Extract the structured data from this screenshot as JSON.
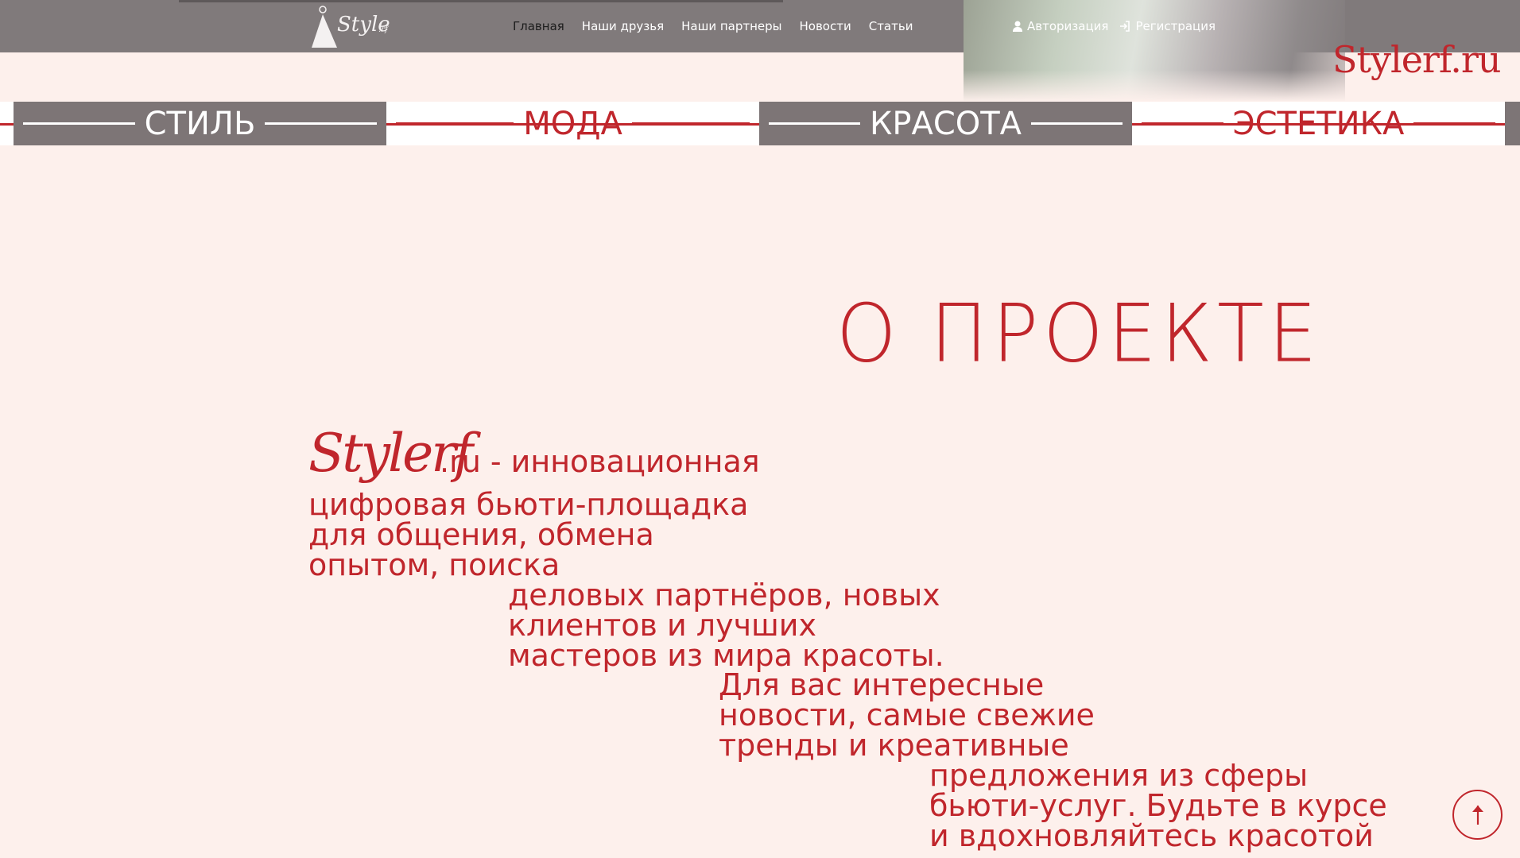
{
  "header": {
    "logo_text": "Style",
    "logo_suffix": ".rf",
    "nav": [
      {
        "label": "Главная",
        "active": true
      },
      {
        "label": "Наши друзья",
        "active": false
      },
      {
        "label": "Наши партнеры",
        "active": false
      },
      {
        "label": "Новости",
        "active": false
      },
      {
        "label": "Статьи",
        "active": false
      }
    ],
    "auth": {
      "login_label": "Авторизация",
      "register_label": "Регистрация"
    },
    "brand": "Stylerf.ru"
  },
  "strip": {
    "words": [
      "СТИЛЬ",
      "МОДА",
      "КРАСОТА",
      "ЭСТЕТИКА"
    ]
  },
  "about": {
    "title": "О ПРОЕКТЕ",
    "script_logo": "Stylerf",
    "lines": [
      ".ru - инновационная",
      "цифровая бьюти-площадка\nдля общения, обмена\nопытом, поиска",
      "деловых партнёров, новых\nклиентов и лучших\nмастеров из мира красоты.",
      "Для вас интересные\nновости, самые свежие\nтренды и креативные",
      "предложения из сферы\nбьюти-услуг. Будьте в курсе\nи вдохновляйтесь красотой"
    ]
  },
  "colors": {
    "accent": "#c0262c",
    "background": "#fdf0ec",
    "header": "#807a7b"
  }
}
